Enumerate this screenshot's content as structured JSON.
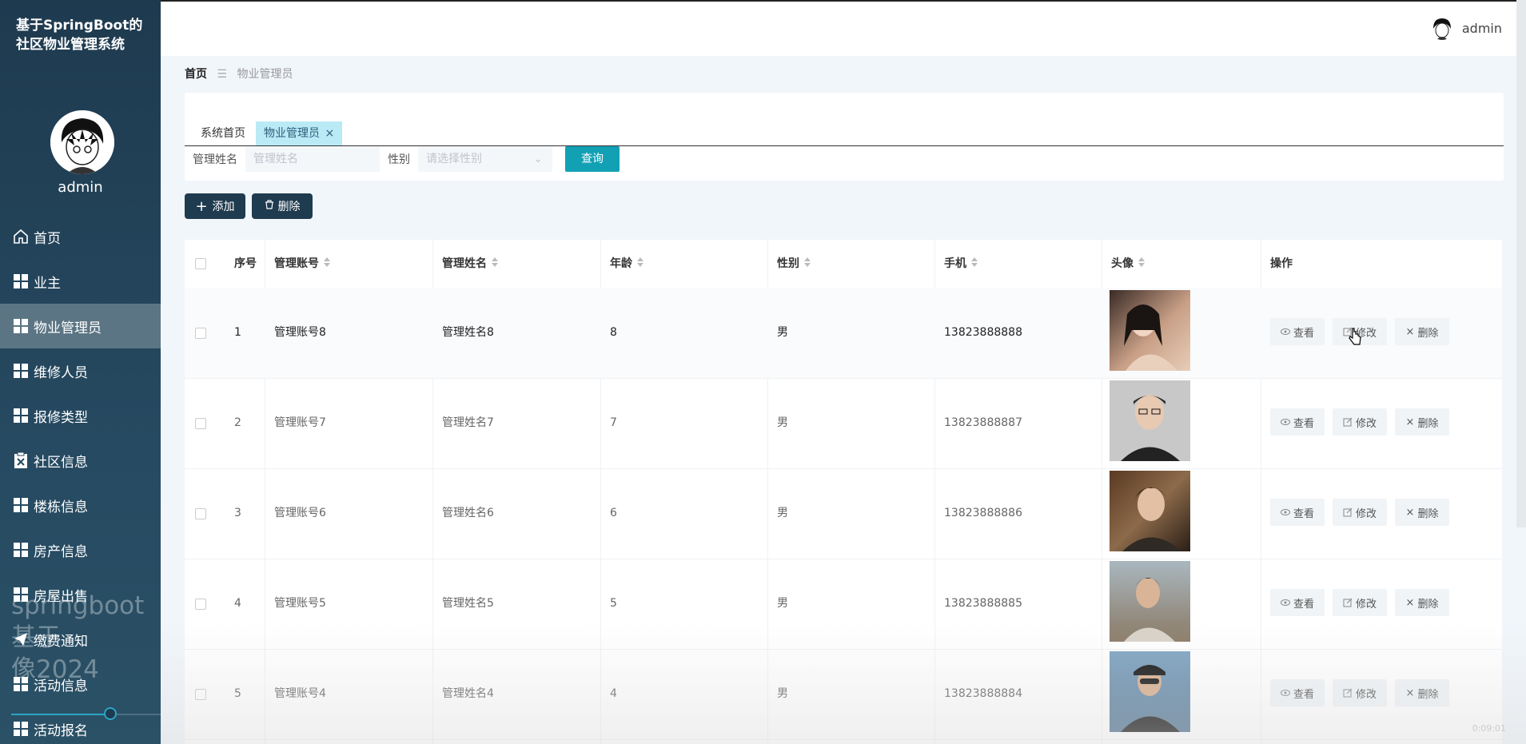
{
  "app": {
    "title": "基于SpringBoot的\n社区物业管理系统",
    "user": "admin"
  },
  "sidebar": {
    "user": "admin",
    "items": [
      {
        "label": "首页",
        "icon": "home-icon"
      },
      {
        "label": "业主",
        "icon": "grid-icon"
      },
      {
        "label": "物业管理员",
        "icon": "grid-icon",
        "active": true
      },
      {
        "label": "维修人员",
        "icon": "grid-icon"
      },
      {
        "label": "报修类型",
        "icon": "grid-icon"
      },
      {
        "label": "社区信息",
        "icon": "clipboard-icon"
      },
      {
        "label": "楼栋信息",
        "icon": "grid-icon"
      },
      {
        "label": "房产信息",
        "icon": "grid-icon"
      },
      {
        "label": "房屋出售",
        "icon": "grid-icon"
      },
      {
        "label": "缴费通知",
        "icon": "send-icon"
      },
      {
        "label": "活动信息",
        "icon": "grid-icon"
      },
      {
        "label": "活动报名",
        "icon": "grid-icon"
      }
    ],
    "watermark": "springboot基于\n像2024"
  },
  "header": {
    "user": "admin"
  },
  "breadcrumb": {
    "home": "首页",
    "separator": "☰",
    "current": "物业管理员"
  },
  "tabs": [
    {
      "label": "系统首页"
    },
    {
      "label": "物业管理员",
      "active": true,
      "closable": true
    }
  ],
  "search": {
    "name_label": "管理姓名",
    "name_placeholder": "管理姓名",
    "gender_label": "性别",
    "gender_placeholder": "请选择性别",
    "query_button": "查询"
  },
  "actions": {
    "add": "添加",
    "delete": "删除"
  },
  "table": {
    "headers": [
      "序号",
      "管理账号",
      "管理姓名",
      "年龄",
      "性别",
      "手机",
      "头像",
      "操作"
    ],
    "rows": [
      {
        "no": "1",
        "account": "管理账号8",
        "name": "管理姓名8",
        "age": "8",
        "gender": "男",
        "phone": "13823888888"
      },
      {
        "no": "2",
        "account": "管理账号7",
        "name": "管理姓名7",
        "age": "7",
        "gender": "男",
        "phone": "13823888887"
      },
      {
        "no": "3",
        "account": "管理账号6",
        "name": "管理姓名6",
        "age": "6",
        "gender": "男",
        "phone": "13823888886"
      },
      {
        "no": "4",
        "account": "管理账号5",
        "name": "管理姓名5",
        "age": "5",
        "gender": "男",
        "phone": "13823888885"
      },
      {
        "no": "5",
        "account": "管理账号4",
        "name": "管理姓名4",
        "age": "4",
        "gender": "男",
        "phone": "13823888884"
      }
    ],
    "ops": {
      "view": "查看",
      "edit": "修改",
      "delete": "删除"
    }
  },
  "timecode": "0:09:01",
  "colors": {
    "sidebar": "#1e3a4f",
    "accent": "#12a0b4",
    "active_tab": "#b9eaf5",
    "dark_button": "#1f3b4f"
  }
}
